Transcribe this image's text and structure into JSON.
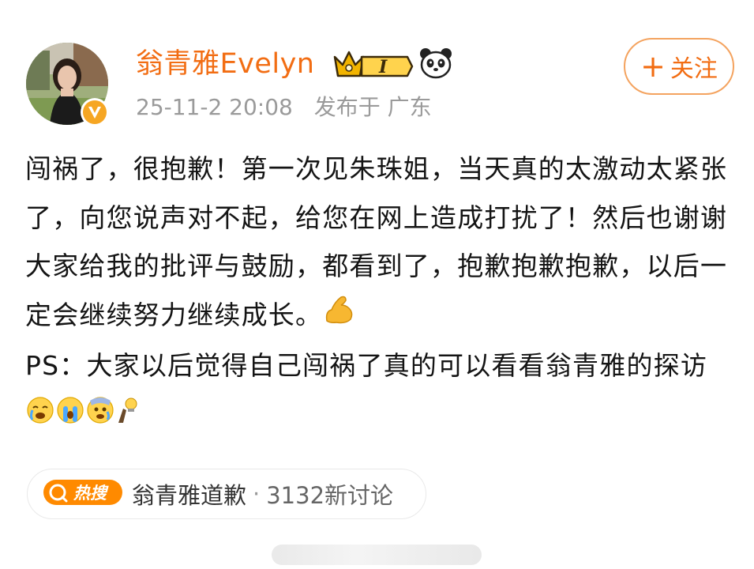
{
  "user": {
    "name": "翁青雅Evelyn",
    "timestamp": "25-11-2 20:08",
    "location": "发布于 广东",
    "level_badge": "I"
  },
  "follow_button": {
    "plus": "+",
    "label": "关注"
  },
  "post": {
    "paragraphs": [
      "闯祸了，很抱歉！第一次见朱珠姐，当天真的太激动太紧张了，向您说声对不起，给您在网上造成打扰了！然后也谢谢大家给我的批评与鼓励，都看到了，抱歉抱歉抱歉，以后一定会继续努力继续成长。",
      "PS：大家以后觉得自己闯祸了真的可以看看翁青雅的探访"
    ]
  },
  "hot_search": {
    "icon_text": "热搜",
    "topic": "翁青雅道歉",
    "separator": "·",
    "count": "3132新讨论"
  },
  "colors": {
    "username": "#f26d13",
    "follow_border": "#f4a35f",
    "meta": "#9a9a9a",
    "hot_icon": "#ff8a00"
  },
  "icons": [
    "avatar",
    "verified-badge-icon",
    "crown-level-icon",
    "panda-icon",
    "muscle-emoji-icon",
    "crying-emoji-icon",
    "sobbing-emoji-icon",
    "scared-emoji-icon",
    "lightbulb-emoji-icon",
    "hot-search-icon"
  ]
}
